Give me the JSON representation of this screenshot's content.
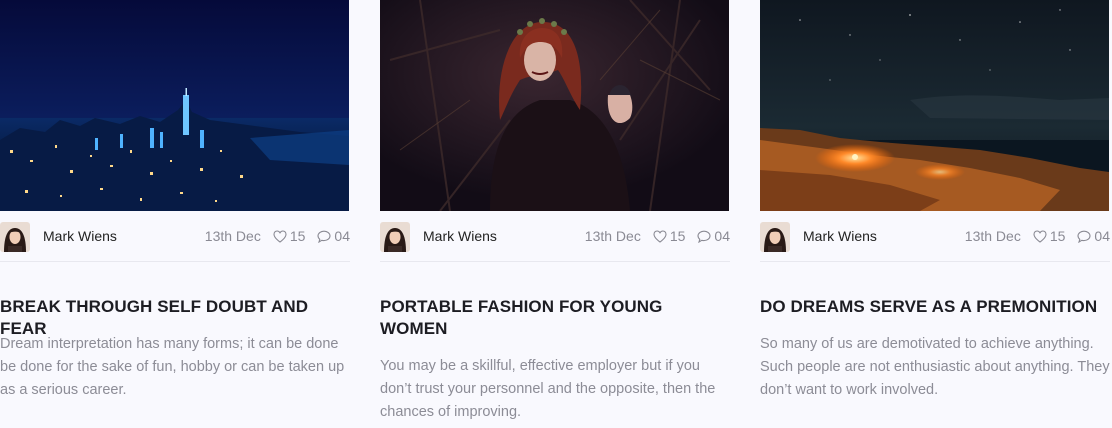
{
  "posts": [
    {
      "image": "night-city-skyline",
      "author": "Mark Wiens",
      "date": "13th Dec",
      "likes": "15",
      "comments": "04",
      "title": "BREAK THROUGH SELF DOUBT AND FEAR",
      "excerpt": "Dream interpretation has many forms; it can be done be done for the sake of fun, hobby or can be taken up as a serious career."
    },
    {
      "image": "woman-in-dark-forest",
      "author": "Mark Wiens",
      "date": "13th Dec",
      "likes": "15",
      "comments": "04",
      "title": "PORTABLE FASHION FOR YOUNG WOMEN",
      "excerpt": "You may be a skillful, effective employer but if you don’t trust your personnel and the opposite, then the chances of improving."
    },
    {
      "image": "coastline-at-night",
      "author": "Mark Wiens",
      "date": "13th Dec",
      "likes": "15",
      "comments": "04",
      "title": "DO DREAMS SERVE AS A PREMONITION",
      "excerpt": "So many of us are demotivated to achieve anything. Such people are not enthusiastic about anything. They don’t want to work involved."
    }
  ],
  "colors": {
    "background": "#f9f9fe",
    "title": "#1d1d23",
    "muted": "#8c8c96"
  },
  "icons": {
    "like": "heart-icon",
    "comment": "comment-icon"
  }
}
